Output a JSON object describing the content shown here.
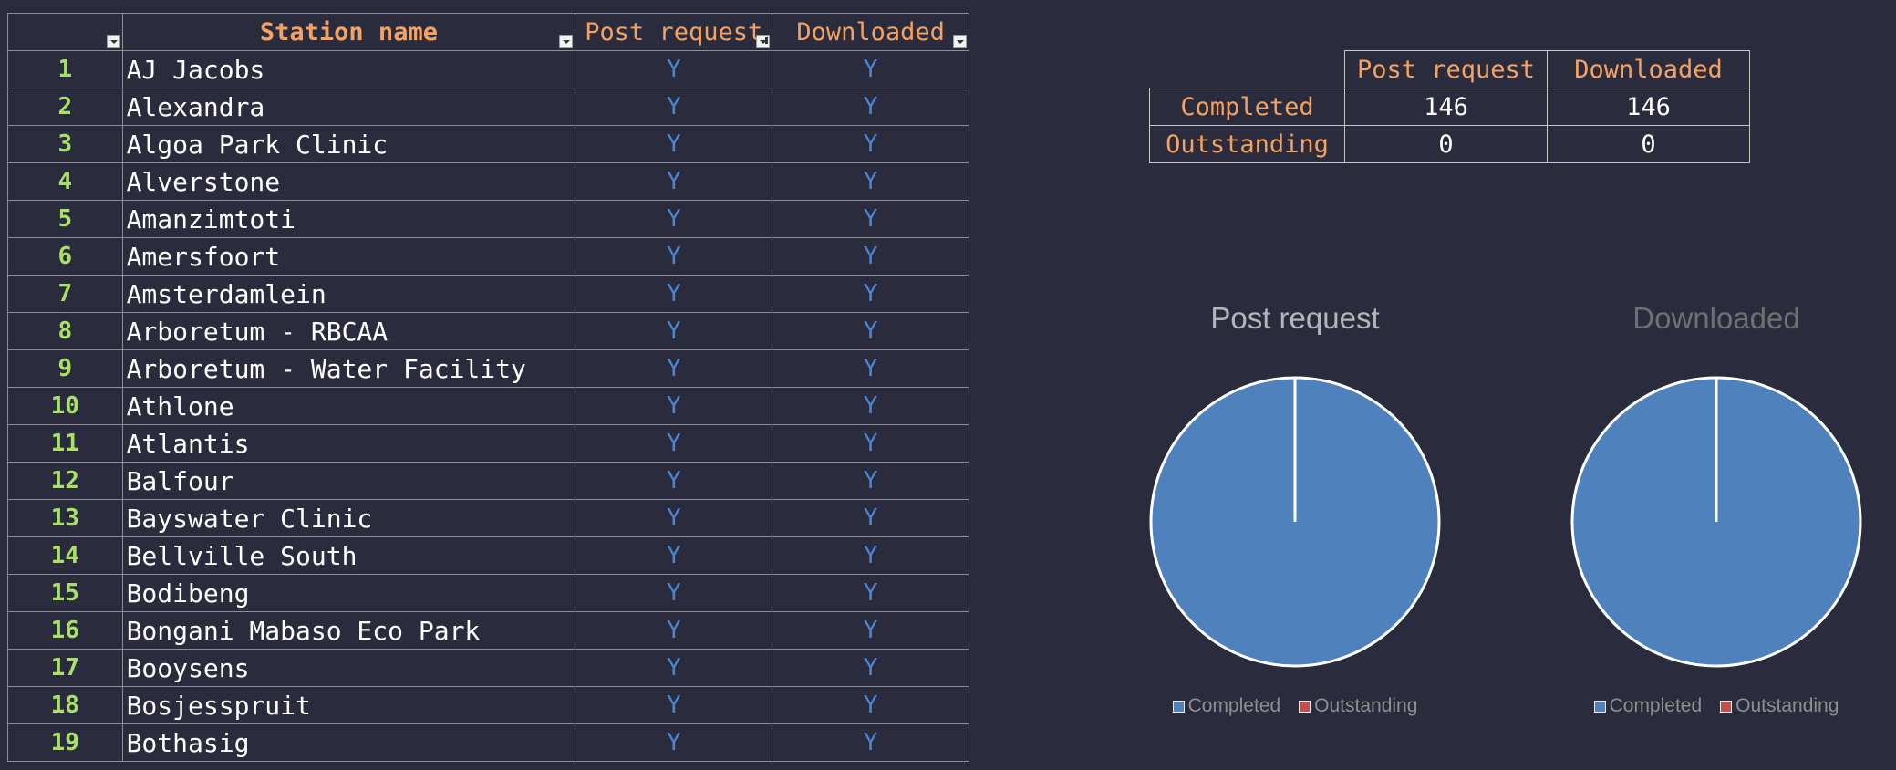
{
  "table": {
    "headers": {
      "station": "Station name",
      "post": "Post request",
      "downloaded": "Downloaded"
    },
    "rows": [
      {
        "n": "1",
        "name": "AJ Jacobs",
        "post": "Y",
        "dl": "Y"
      },
      {
        "n": "2",
        "name": "Alexandra",
        "post": "Y",
        "dl": "Y"
      },
      {
        "n": "3",
        "name": "Algoa Park Clinic",
        "post": "Y",
        "dl": "Y"
      },
      {
        "n": "4",
        "name": "Alverstone",
        "post": "Y",
        "dl": "Y"
      },
      {
        "n": "5",
        "name": "Amanzimtoti",
        "post": "Y",
        "dl": "Y"
      },
      {
        "n": "6",
        "name": "Amersfoort",
        "post": "Y",
        "dl": "Y"
      },
      {
        "n": "7",
        "name": "Amsterdamlein",
        "post": "Y",
        "dl": "Y"
      },
      {
        "n": "8",
        "name": "Arboretum - RBCAA",
        "post": "Y",
        "dl": "Y"
      },
      {
        "n": "9",
        "name": "Arboretum - Water Facility",
        "post": "Y",
        "dl": "Y"
      },
      {
        "n": "10",
        "name": "Athlone",
        "post": "Y",
        "dl": "Y"
      },
      {
        "n": "11",
        "name": "Atlantis",
        "post": "Y",
        "dl": "Y"
      },
      {
        "n": "12",
        "name": "Balfour",
        "post": "Y",
        "dl": "Y"
      },
      {
        "n": "13",
        "name": "Bayswater Clinic",
        "post": "Y",
        "dl": "Y"
      },
      {
        "n": "14",
        "name": "Bellville South",
        "post": "Y",
        "dl": "Y"
      },
      {
        "n": "15",
        "name": "Bodibeng",
        "post": "Y",
        "dl": "Y"
      },
      {
        "n": "16",
        "name": "Bongani Mabaso Eco Park",
        "post": "Y",
        "dl": "Y"
      },
      {
        "n": "17",
        "name": "Booysens",
        "post": "Y",
        "dl": "Y"
      },
      {
        "n": "18",
        "name": "Bosjesspruit",
        "post": "Y",
        "dl": "Y"
      },
      {
        "n": "19",
        "name": "Bothasig",
        "post": "Y",
        "dl": "Y"
      }
    ]
  },
  "summary": {
    "col_headers": [
      "Post request",
      "Downloaded"
    ],
    "rows": [
      {
        "label": "Completed",
        "post": "146",
        "dl": "146"
      },
      {
        "label": "Outstanding",
        "post": "0",
        "dl": "0"
      }
    ]
  },
  "chart_data": [
    {
      "type": "pie",
      "title": "Post request",
      "categories": [
        "Completed",
        "Outstanding"
      ],
      "values": [
        146,
        0
      ],
      "colors": [
        "#4f81bd",
        "#c0504d"
      ],
      "legend": "bottom"
    },
    {
      "type": "pie",
      "title": "Downloaded",
      "categories": [
        "Completed",
        "Outstanding"
      ],
      "values": [
        146,
        0
      ],
      "colors": [
        "#4f81bd",
        "#c0504d"
      ],
      "legend": "bottom"
    }
  ],
  "colors": {
    "background": "#2a2c3d",
    "header_text": "#f4a261",
    "row_number": "#a8e06a",
    "flag": "#4a86d6",
    "chart_title_1": "#b5b5b5",
    "chart_title_2": "#707070"
  }
}
